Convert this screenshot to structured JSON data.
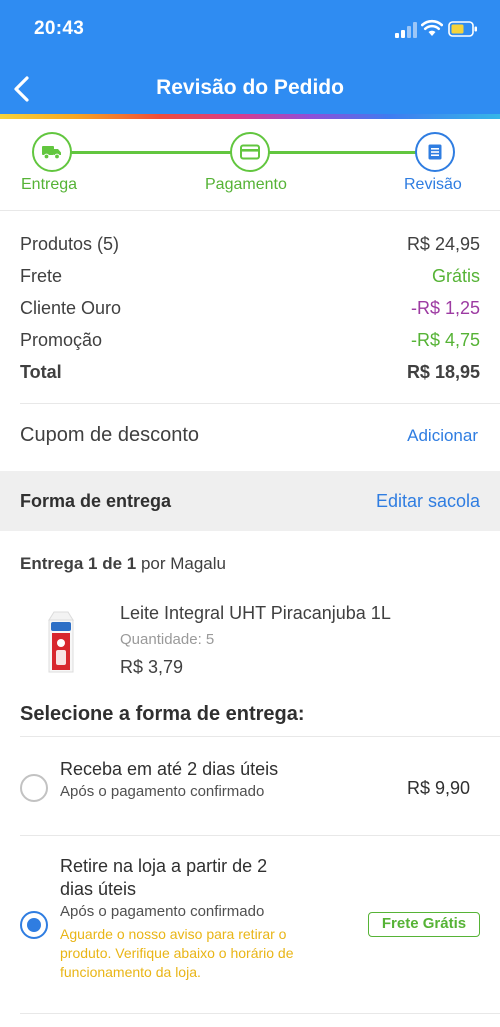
{
  "status_bar": {
    "time": "20:43"
  },
  "header": {
    "title": "Revisão do Pedido"
  },
  "steps": [
    {
      "label": "Entrega",
      "icon": "truck-icon"
    },
    {
      "label": "Pagamento",
      "icon": "credit-card-icon"
    },
    {
      "label": "Revisão",
      "icon": "document-icon"
    }
  ],
  "summary": {
    "products": {
      "label": "Produtos (5)",
      "value": "R$ 24,95"
    },
    "shipping": {
      "label": "Frete",
      "value": "Grátis"
    },
    "gold_client": {
      "label": "Cliente Ouro",
      "value": "-R$ 1,25"
    },
    "promotion": {
      "label": "Promoção",
      "value": "-R$ 4,75"
    },
    "total": {
      "label": "Total",
      "value": "R$ 18,95"
    }
  },
  "coupon": {
    "label": "Cupom de desconto",
    "action": "Adicionar"
  },
  "delivery_section": {
    "title": "Forma de entrega",
    "edit": "Editar sacola"
  },
  "delivery_info": {
    "bold": "Entrega 1 de 1",
    "rest": " por Magalu"
  },
  "product": {
    "name": "Leite Integral UHT Piracanjuba 1L",
    "quantity": "Quantidade: 5",
    "price": "R$ 3,79"
  },
  "select_title": "Selecione a forma de entrega:",
  "options": [
    {
      "title": "Receba em até 2 dias úteis",
      "subtitle": "Após o pagamento confirmado",
      "price": "R$ 9,90",
      "selected": false
    },
    {
      "title_line1": "Retire na loja a partir de 2",
      "title_line2": "dias úteis",
      "subtitle": "Após o pagamento confirmado",
      "note_line1": "Aguarde o nosso aviso para retirar o",
      "note_line2": "produto. Verifique abaixo o horário de",
      "note_line3": "funcionamento da loja.",
      "badge": "Frete Grátis",
      "selected": true
    }
  ],
  "colors": {
    "brand_blue": "#2f8cf2",
    "link_blue": "#2f7de1",
    "green": "#56b336",
    "purple": "#9d3ba2",
    "warning_yellow": "#e9b516"
  }
}
